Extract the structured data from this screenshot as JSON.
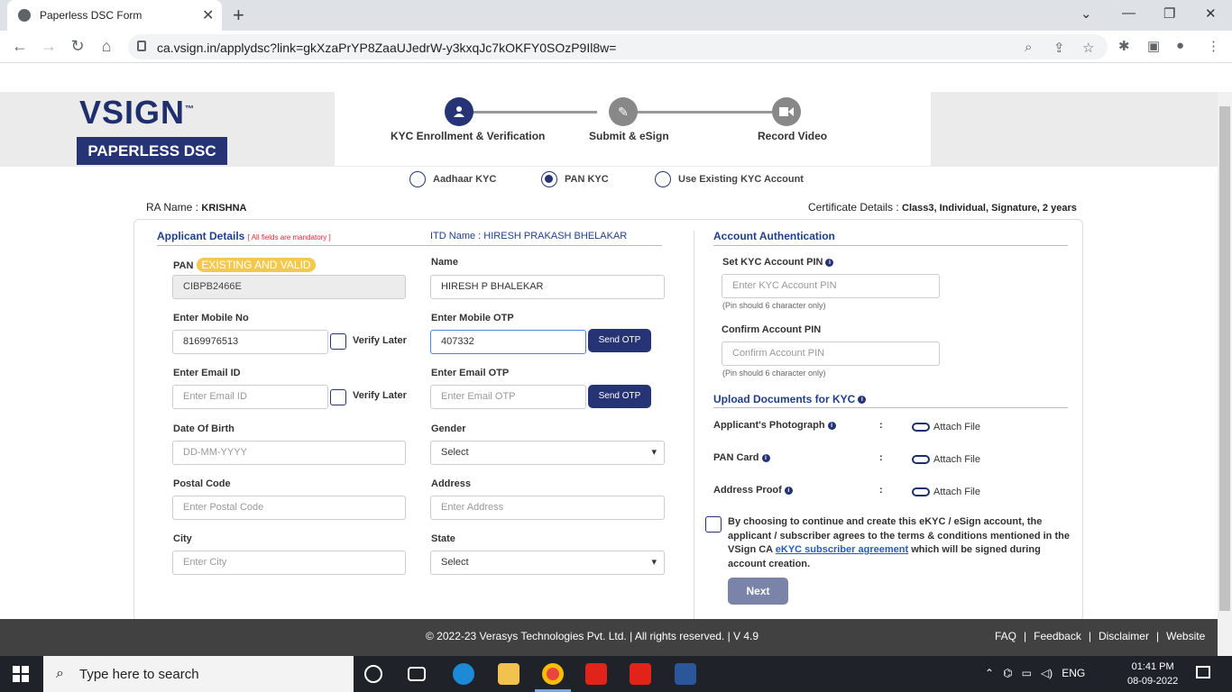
{
  "browser": {
    "tab_title": "Paperless DSC Form",
    "url": "ca.vsign.in/applydsc?link=gkXzaPrYP8ZaaUJedrW-y3kxqJc7kOKFY0SOzP9Il8w="
  },
  "logo": {
    "vsign": "VSIGN",
    "tm": "™",
    "paperless": "PAPERLESS DSC"
  },
  "steps": [
    {
      "label": "KYC Enrollment & Verification",
      "icon": "user-icon",
      "active": true
    },
    {
      "label": "Submit & eSign",
      "icon": "pencil-icon",
      "active": false
    },
    {
      "label": "Record Video",
      "icon": "video-icon",
      "active": false
    }
  ],
  "kyc_options": [
    {
      "label": "Aadhaar KYC",
      "checked": false
    },
    {
      "label": "PAN KYC",
      "checked": true
    },
    {
      "label": "Use Existing KYC Account",
      "checked": false
    }
  ],
  "ra": {
    "label": "RA Name :",
    "value": "KRISHNA"
  },
  "certificate": {
    "label": "Certificate Details :",
    "value": "Class3, Individual, Signature, 2 years"
  },
  "applicant": {
    "title": "Applicant Details",
    "mandatory": "[ All fields are mandatory ]",
    "itd_name": "ITD Name : HIRESH PRAKASH BHELAKAR",
    "pan_label": "PAN",
    "pan_badge": "EXISTING AND VALID",
    "pan_value": "CIBPB2466E",
    "name_label": "Name",
    "name_value": "HIRESH P BHALEKAR",
    "mobile_label": "Enter Mobile No",
    "mobile_value": "8169976513",
    "verify_later": "Verify Later",
    "mobile_otp_label": "Enter Mobile OTP",
    "mobile_otp_value": "407332",
    "send_otp": "Send OTP",
    "email_label": "Enter Email ID",
    "email_placeholder": "Enter Email ID",
    "email_otp_label": "Enter Email OTP",
    "email_otp_placeholder": "Enter Email OTP",
    "dob_label": "Date Of Birth",
    "dob_placeholder": "DD-MM-YYYY",
    "gender_label": "Gender",
    "gender_value": "Select",
    "postal_label": "Postal Code",
    "postal_placeholder": "Enter Postal Code",
    "address_label": "Address",
    "address_placeholder": "Enter Address",
    "city_label": "City",
    "city_placeholder": "Enter City",
    "state_label": "State",
    "state_value": "Select"
  },
  "account": {
    "title": "Account Authentication",
    "set_pin_label": "Set KYC Account PIN",
    "set_pin_placeholder": "Enter KYC Account PIN",
    "pin_hint": "(Pin should 6 character only)",
    "confirm_pin_label": "Confirm Account PIN",
    "confirm_pin_placeholder": "Confirm Account PIN"
  },
  "upload": {
    "title": "Upload Documents for KYC",
    "colon": ":",
    "attach": "Attach File",
    "docs": [
      "Applicant's Photograph",
      "PAN Card",
      "Address Proof"
    ]
  },
  "agreement": {
    "text_before": "By choosing to continue and create this eKYC / eSign account, the applicant / subscriber agrees to the terms & conditions mentioned in the VSign CA",
    "link": "eKYC subscriber agreement",
    "text_after": "which will be signed during account creation."
  },
  "next_button": "Next",
  "footer": {
    "copyright": "©  2022-23  Verasys Technologies Pvt. Ltd. | All rights reserved. | V 4.9",
    "links": [
      "FAQ",
      "Feedback",
      "Disclaimer",
      "Website"
    ],
    "sep": "|"
  },
  "taskbar": {
    "search_placeholder": "Type here to search",
    "lang": "ENG",
    "time": "01:41 PM",
    "date": "08-09-2022"
  }
}
